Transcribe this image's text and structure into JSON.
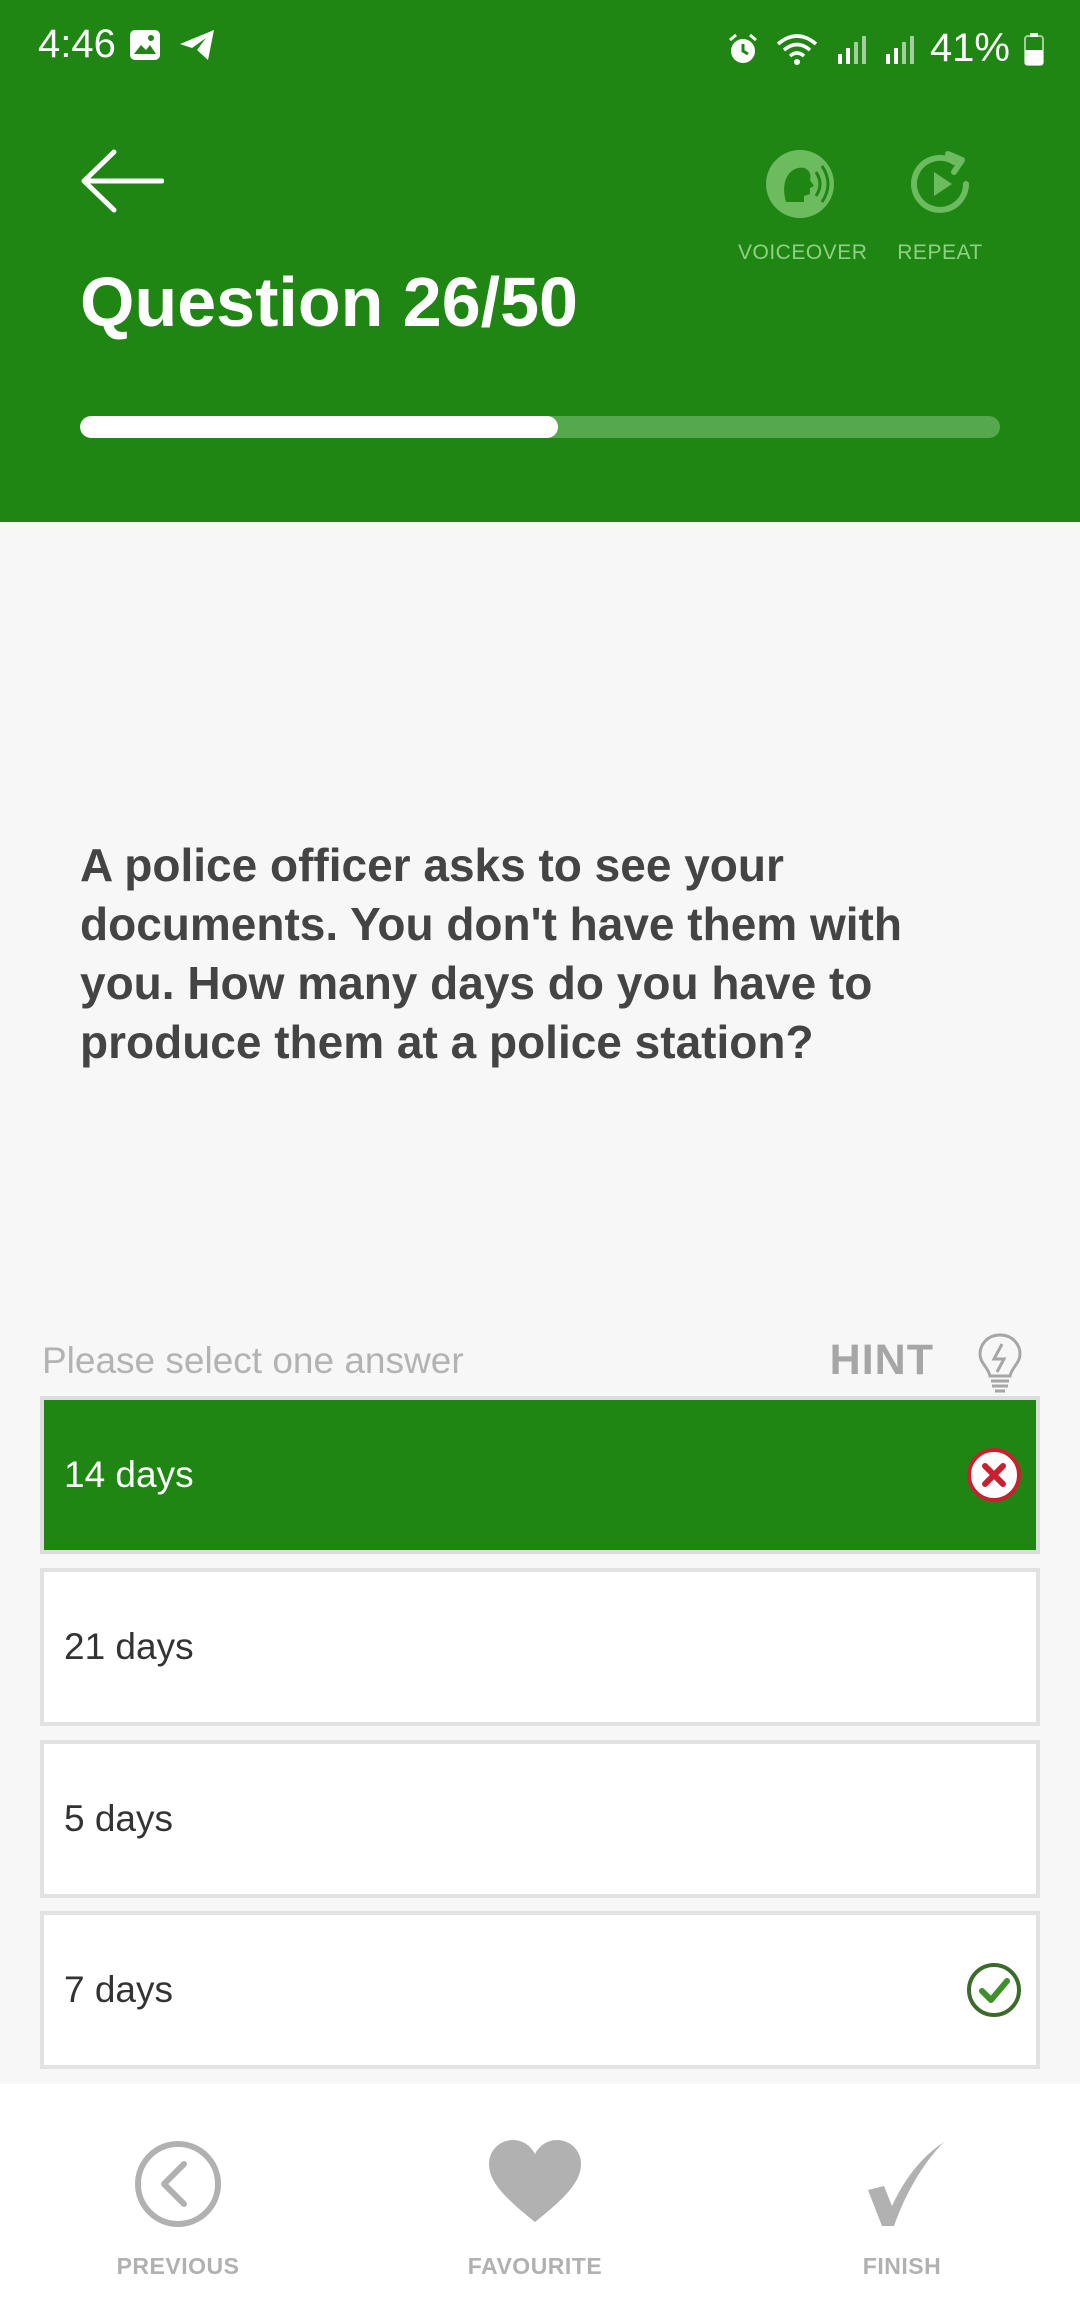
{
  "status_bar": {
    "time": "4:46",
    "battery": "41%"
  },
  "header": {
    "title": "Question 26/50",
    "voiceover_label": "VOICEOVER",
    "repeat_label": "REPEAT",
    "progress": 0.52,
    "background_color": "#208613"
  },
  "question": {
    "text": "A police officer asks to see your documents. You don't have them with you. How many days do you have to produce them at a police station?"
  },
  "answers_section": {
    "prompt": "Please select one answer",
    "hint_label": "HINT"
  },
  "answers": [
    {
      "label": "14 days",
      "state": "selected-wrong",
      "mark": "cross-icon"
    },
    {
      "label": "21 days",
      "state": "none",
      "mark": ""
    },
    {
      "label": "5 days",
      "state": "none",
      "mark": ""
    },
    {
      "label": "7 days",
      "state": "correct",
      "mark": "check-icon"
    }
  ],
  "bottom_nav": {
    "previous_label": "PREVIOUS",
    "favourite_label": "FAVOURITE",
    "finish_label": "FINISH"
  }
}
